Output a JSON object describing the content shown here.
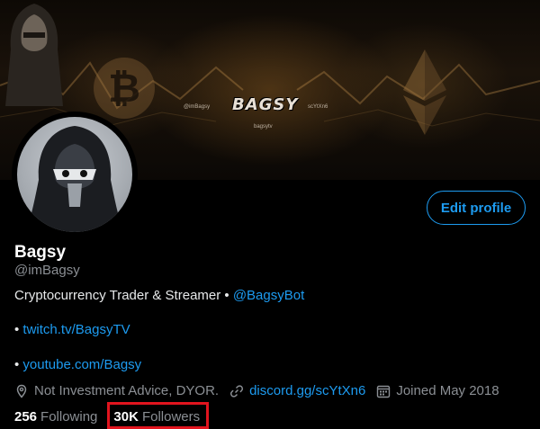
{
  "banner": {
    "logo_text": "BAGSY",
    "twitter_handle": "@imBagsy",
    "discord_code": "scYtXn6",
    "twitch_name": "bagsytv"
  },
  "profile": {
    "name": "Bagsy",
    "handle": "@imBagsy",
    "edit_label": "Edit profile",
    "bio_text": "Cryptocurrency Trader & Streamer • ",
    "bio_mention": "@BagsyBot",
    "link1_bullet": "• ",
    "link1": "twitch.tv/BagsyTV",
    "link2_bullet": "• ",
    "link2": "youtube.com/Bagsy"
  },
  "meta": {
    "location": "Not Investment Advice, DYOR.",
    "website": "discord.gg/scYtXn6",
    "joined": "Joined May 2018"
  },
  "stats": {
    "following_count": "256",
    "following_label": "Following",
    "followers_count": "30K",
    "followers_label": "Followers"
  },
  "colors": {
    "accent": "#1d9bf0",
    "highlight_box": "#e1141e",
    "background": "#000000"
  },
  "icons": [
    "location-icon",
    "link-icon",
    "calendar-icon",
    "bitcoin-icon",
    "ethereum-icon"
  ]
}
